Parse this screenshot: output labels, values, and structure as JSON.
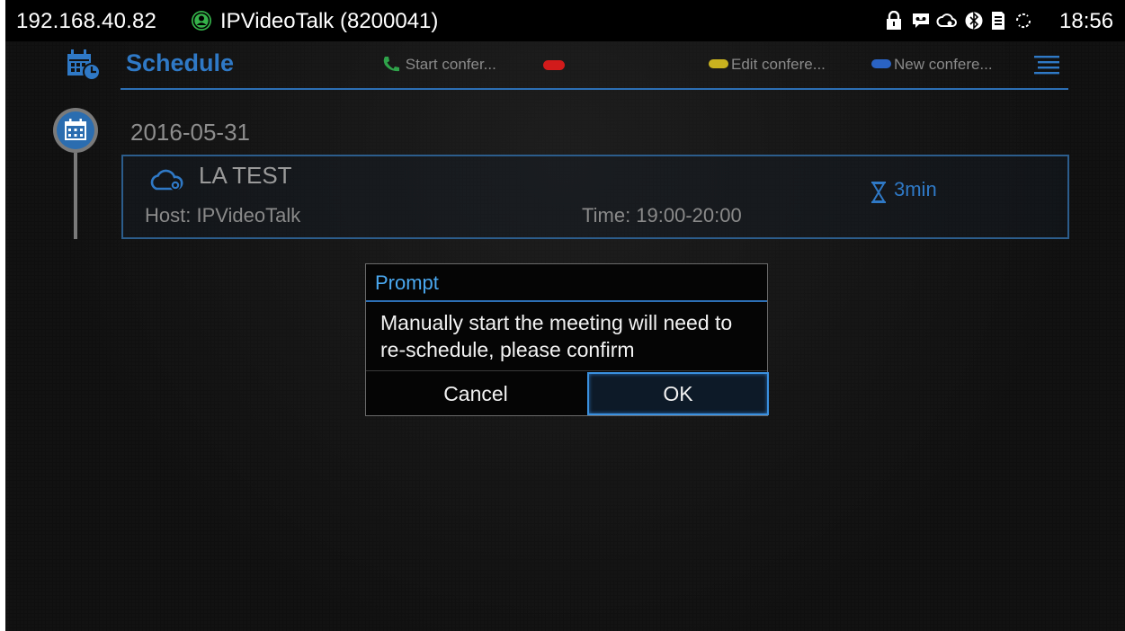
{
  "status_bar": {
    "ip_address": "192.168.40.82",
    "account": "IPVideoTalk (8200041)",
    "account_icon": "user-circle-icon",
    "time": "18:56",
    "icons": [
      "lock-icon",
      "voicemail-icon",
      "cloud-icon",
      "bluetooth-icon",
      "sd-card-icon",
      "sync-icon"
    ]
  },
  "header": {
    "title": "Schedule",
    "title_icon": "calendar-clock-icon",
    "actions": {
      "start": "Start confer...",
      "edit": "Edit confere...",
      "new": "New confere..."
    },
    "menu_icon": "menu-icon"
  },
  "schedule": {
    "date": "2016-05-31",
    "meeting": {
      "title": "LA TEST",
      "host": "Host: IPVideoTalk",
      "time": "Time: 19:00-20:00",
      "duration": "3min"
    }
  },
  "dialog": {
    "title": "Prompt",
    "message": "Manually start the meeting will need to re-schedule, please confirm",
    "cancel_label": "Cancel",
    "ok_label": "OK"
  },
  "colors": {
    "accent_blue": "#2f79c6",
    "green": "#2fa34a",
    "red": "#d21b1b",
    "yellow": "#c9b21f",
    "blue_pill": "#2a63c4"
  }
}
